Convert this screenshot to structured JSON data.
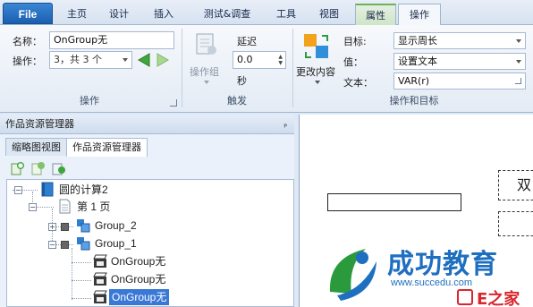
{
  "tabs": {
    "file": "File",
    "items": [
      "主页",
      "设计",
      "插入",
      "测试&调查",
      "工具",
      "视图",
      "属性",
      "操作"
    ]
  },
  "ribbon": {
    "name_label": "名称：",
    "name_value": "OnGroup无",
    "action_label": "操作：",
    "action_value": "3，共 3 个",
    "group1_label": "操作",
    "action_group_button": "操作组",
    "delay_label": "延迟",
    "delay_value": "0.0",
    "seconds_label": "秒",
    "group2_label": "触发",
    "change_content_button": "更改内容",
    "target_label": "目标:",
    "target_value": "显示周长",
    "value_label": "值：",
    "value_value": "设置文本",
    "text_label": "文本：",
    "text_value": "VAR(r)",
    "group3_label": "操作和目标"
  },
  "panel": {
    "title": "作品资源管理器",
    "tab_thumbnail": "缩略图视图",
    "tab_explorer": "作品资源管理器"
  },
  "tree": {
    "root": "圆的计算2",
    "page": "第 1 页",
    "group2": "Group_2",
    "group1": "Group_1",
    "item1": "OnGroup无",
    "item2": "OnGroup无",
    "item3": "OnGroup无"
  },
  "canvas": {
    "text_box": "双",
    "logo_text": "成功教育",
    "logo_url": "www.succedu.com",
    "watermark": "E之家"
  },
  "colors": {
    "accent": "#3a78d6",
    "file_tab": "#1b5fb0",
    "logo_green": "#2a9a3c",
    "logo_blue": "#1f6fc0",
    "watermark_red": "#d9262c"
  }
}
